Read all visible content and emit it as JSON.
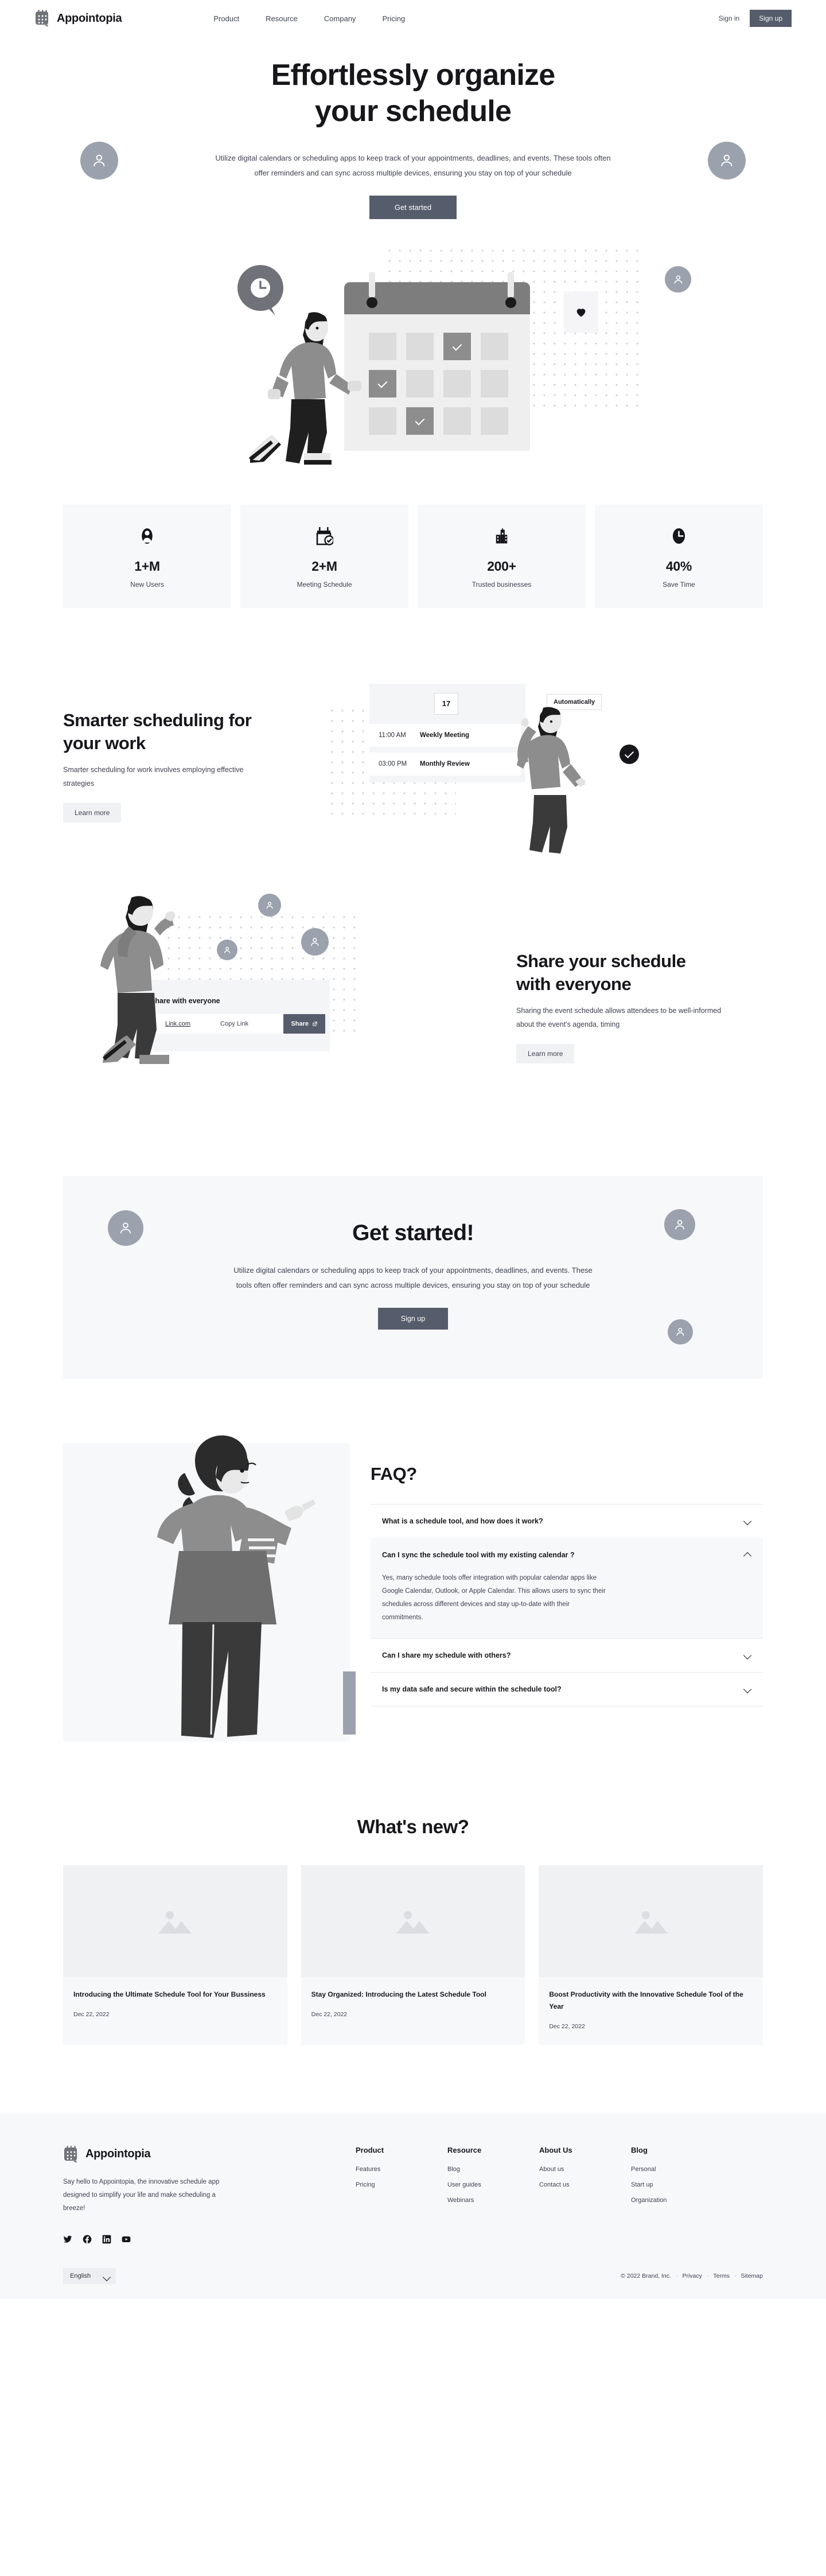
{
  "brand": {
    "name": "Appointopia",
    "logo_icon": "calendar-logo-icon"
  },
  "nav": {
    "links": [
      {
        "label": "Product"
      },
      {
        "label": "Resource"
      },
      {
        "label": "Company"
      },
      {
        "label": "Pricing"
      }
    ],
    "sign_in": "Sign in",
    "sign_up": "Sign up"
  },
  "hero": {
    "title_line1": "Effortlessly organize",
    "title_line2": "your schedule",
    "subtitle": "Utilize digital calendars or scheduling apps to keep track of your appointments, deadlines, and events. These tools often offer reminders and can sync across multiple devices, ensuring you stay on top of your schedule",
    "cta": "Get started"
  },
  "stats": [
    {
      "icon": "user-icon",
      "value": "1+M",
      "label": "New Users"
    },
    {
      "icon": "calendar-check-icon",
      "value": "2+M",
      "label": "Meeting Schedule"
    },
    {
      "icon": "buildings-icon",
      "value": "200+",
      "label": "Trusted businesses"
    },
    {
      "icon": "clock-icon",
      "value": "40%",
      "label": "Save Time"
    }
  ],
  "feature_smarter": {
    "title_line1": "Smarter scheduling for",
    "title_line2": "your work",
    "body": "Smarter scheduling for work involves employing effective strategies",
    "cta": "Learn more",
    "widget": {
      "day": "17",
      "chip": "Automatically",
      "rows": [
        {
          "time": "11:00 AM",
          "name": "Weekly Meeting"
        },
        {
          "time": "03:00 PM",
          "name": "Monthly Review"
        }
      ]
    }
  },
  "feature_share": {
    "title_line1": "Share your schedule",
    "title_line2": "with everyone",
    "body": "Sharing the event schedule allows attendees to be well-informed about the event's agenda, timing",
    "cta": "Learn more",
    "widget": {
      "title": "Share with everyone",
      "link": "Link.com",
      "copy": "Copy Link",
      "share": "Share"
    }
  },
  "cta": {
    "title": "Get started!",
    "body": "Utilize digital calendars or scheduling apps to keep track of your appointments, deadlines, and events. These tools often offer reminders and can sync across multiple devices, ensuring you stay on top of your schedule",
    "button": "Sign up"
  },
  "faq": {
    "title": "FAQ?",
    "items": [
      {
        "q": "What is a schedule tool, and how does it work?",
        "a": "",
        "open": false
      },
      {
        "q": "Can I sync the schedule tool with my existing calendar ?",
        "a": "Yes, many schedule tools offer integration with popular calendar apps like Google Calendar, Outlook, or Apple Calendar. This allows users to sync their schedules across different devices and stay up-to-date with their commitments.",
        "open": true
      },
      {
        "q": "Can I share my schedule with others?",
        "a": "",
        "open": false
      },
      {
        "q": "Is my data safe and secure within the schedule tool?",
        "a": "",
        "open": false
      }
    ]
  },
  "news": {
    "title": "What's new?",
    "cards": [
      {
        "title": "Introducing the Ultimate Schedule Tool for Your Bussiness",
        "date": "Dec 22, 2022"
      },
      {
        "title": "Stay Organized: Introducing the Latest Schedule Tool",
        "date": "Dec 22, 2022"
      },
      {
        "title": "Boost Productivity with the Innovative Schedule Tool of the Year",
        "date": "Dec 22, 2022"
      }
    ]
  },
  "footer": {
    "about": "Say hello to Appointopia, the innovative schedule app designed to simplify your life and make scheduling a breeze!",
    "socials": [
      {
        "icon": "twitter-icon"
      },
      {
        "icon": "facebook-icon"
      },
      {
        "icon": "linkedin-icon"
      },
      {
        "icon": "youtube-icon"
      }
    ],
    "columns": [
      {
        "heading": "Product",
        "links": [
          "Features",
          "Pricing"
        ]
      },
      {
        "heading": "Resource",
        "links": [
          "Blog",
          "User guides",
          "Webinars"
        ]
      },
      {
        "heading": "About Us",
        "links": [
          "About us",
          "Contact us"
        ]
      },
      {
        "heading": "Blog",
        "links": [
          "Personal",
          "Start up",
          "Organization"
        ]
      }
    ],
    "language": "English",
    "copyright": "© 2022 Brand, Inc.",
    "legal": [
      "Privacy",
      "Terms",
      "Sitemap"
    ]
  },
  "colors": {
    "accent": "#555c6b",
    "ink": "#17171b",
    "panel": "#f7f8fa",
    "avatar": "#9ba1ad"
  }
}
